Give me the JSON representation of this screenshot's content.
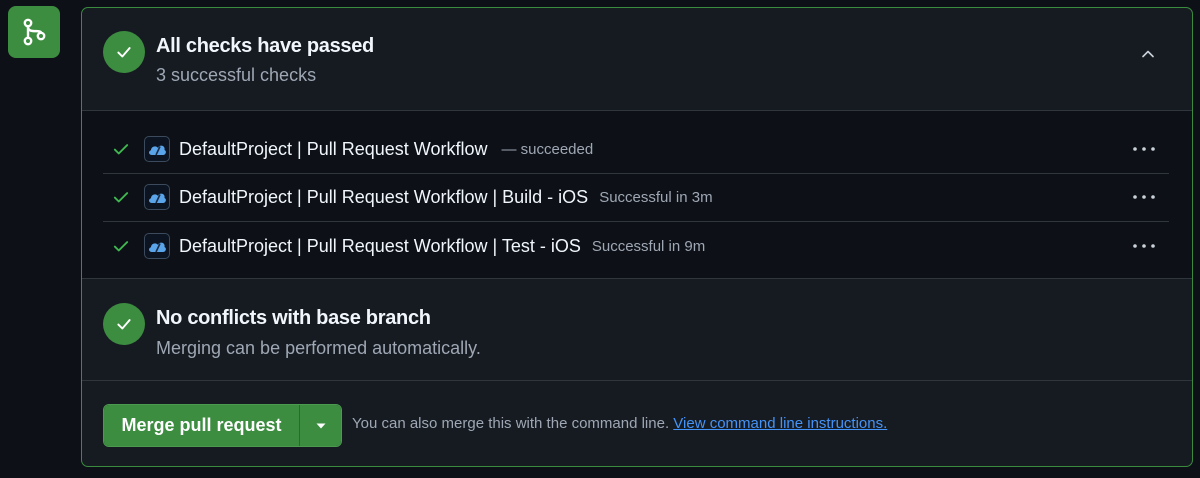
{
  "checks": {
    "title": "All checks have passed",
    "subtitle": "3 successful checks",
    "items": [
      {
        "name": "DefaultProject | Pull Request Workflow",
        "status": "— succeeded"
      },
      {
        "name": "DefaultProject | Pull Request Workflow | Build - iOS",
        "status": "Successful in 3m"
      },
      {
        "name": "DefaultProject | Pull Request Workflow | Test - iOS",
        "status": "Successful in 9m"
      }
    ]
  },
  "conflicts": {
    "title": "No conflicts with base branch",
    "subtitle": "Merging can be performed automatically."
  },
  "merge": {
    "button_label": "Merge pull request",
    "hint_text": "You can also merge this with the command line.",
    "link_text": "View command line instructions."
  },
  "icons": {
    "branch": "git-branch-icon",
    "check": "check-icon",
    "collapse": "chevron-up-icon",
    "more": "kebab-horizontal-icon",
    "app": "xcode-cloud-icon",
    "caret": "triangle-down-icon"
  },
  "colors": {
    "success": "#3c8d40",
    "link": "#4493f8",
    "background": "#0d1117",
    "panel": "#161b22"
  }
}
